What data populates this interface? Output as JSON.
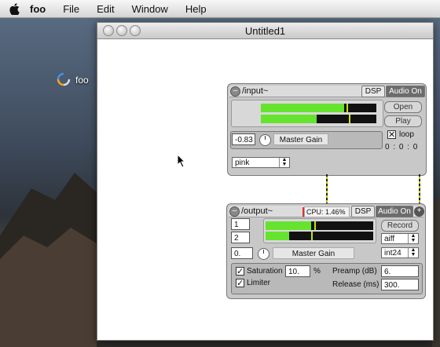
{
  "menubar": {
    "app": "foo",
    "items": [
      "File",
      "Edit",
      "Window",
      "Help"
    ]
  },
  "desktop": {
    "icon_label": "foo"
  },
  "window": {
    "title": "Untitled1"
  },
  "input_panel": {
    "name": "/input~",
    "dsp": "DSP",
    "audio_on": "Audio On",
    "open": "Open",
    "play": "Play",
    "loop": "loop",
    "loop_checked": true,
    "time": "0 : 0 : 0",
    "gain_value": "-0.83",
    "gain_label": "Master Gain",
    "source": "pink",
    "meter_levels": [
      0.72,
      0.48
    ],
    "meter_peaks": [
      0.74,
      0.76
    ]
  },
  "output_panel": {
    "name": "/output~",
    "cpu": "CPU: 1.46%",
    "dsp": "DSP",
    "audio_on": "Audio On",
    "channel_1": "1",
    "channel_2": "2",
    "record": "Record",
    "format": "aiff",
    "bit_depth": "int24",
    "gain_value": "0.",
    "gain_label": "Master Gain",
    "saturation_label": "Saturation",
    "saturation_checked": true,
    "saturation_value": "10.",
    "percent": "%",
    "limiter_label": "Limiter",
    "limiter_checked": true,
    "preamp_label": "Preamp (dB)",
    "preamp_value": "6.",
    "release_label": "Release (ms)",
    "release_value": "300.",
    "meter_levels": [
      0.42,
      0.22
    ],
    "meter_peaks": [
      0.45,
      0.42
    ]
  }
}
